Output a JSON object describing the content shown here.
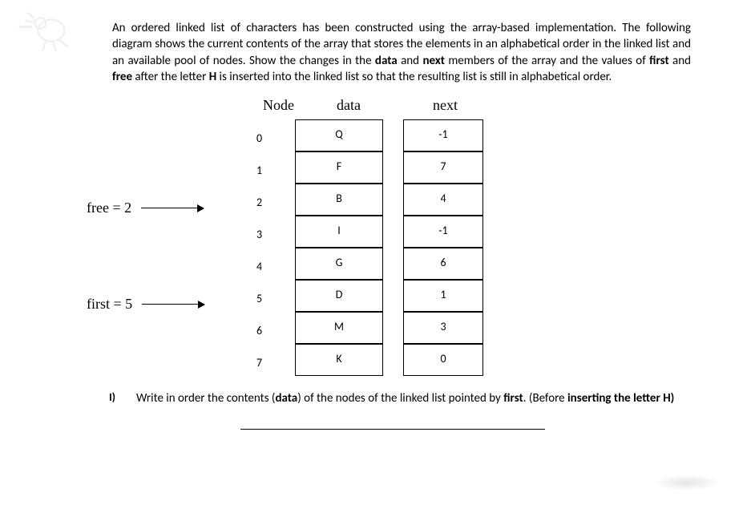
{
  "problem": {
    "p1a": "An ordered linked list of characters has been constructed using the array-based implementation. The following diagram shows the current contents of the array that stores the elements in an alphabetical order in the linked list and an available pool of nodes. Show the changes in the ",
    "b1": "data",
    "p1b": " and ",
    "b2": "next",
    "p1c": " members of the array and the values of ",
    "b3": "first",
    "p1d": " and ",
    "b4": "free",
    "p1e": " after the letter ",
    "b5": "H",
    "p1f": " is inserted into the linked list so that the resulting list is still in alphabetical order."
  },
  "headers": {
    "node": "Node",
    "data": "data",
    "next": "next"
  },
  "pointers": {
    "free_label": "free = 2",
    "first_label": "first = 5"
  },
  "rows": [
    {
      "idx": "0",
      "data": "Q",
      "next": "-1"
    },
    {
      "idx": "1",
      "data": "F",
      "next": "7"
    },
    {
      "idx": "2",
      "data": "B",
      "next": "4"
    },
    {
      "idx": "3",
      "data": "I",
      "next": "-1"
    },
    {
      "idx": "4",
      "data": "G",
      "next": "6"
    },
    {
      "idx": "5",
      "data": "D",
      "next": "1"
    },
    {
      "idx": "6",
      "data": "M",
      "next": "3"
    },
    {
      "idx": "7",
      "data": "K",
      "next": "0"
    }
  ],
  "question": {
    "num": "I)",
    "t1": "Write in order the contents (",
    "tb1": "data",
    "t2": ") of the nodes of the linked list pointed by ",
    "tb2": "first",
    "t3": ". (Before ",
    "tb3": "inserting the letter H)"
  }
}
